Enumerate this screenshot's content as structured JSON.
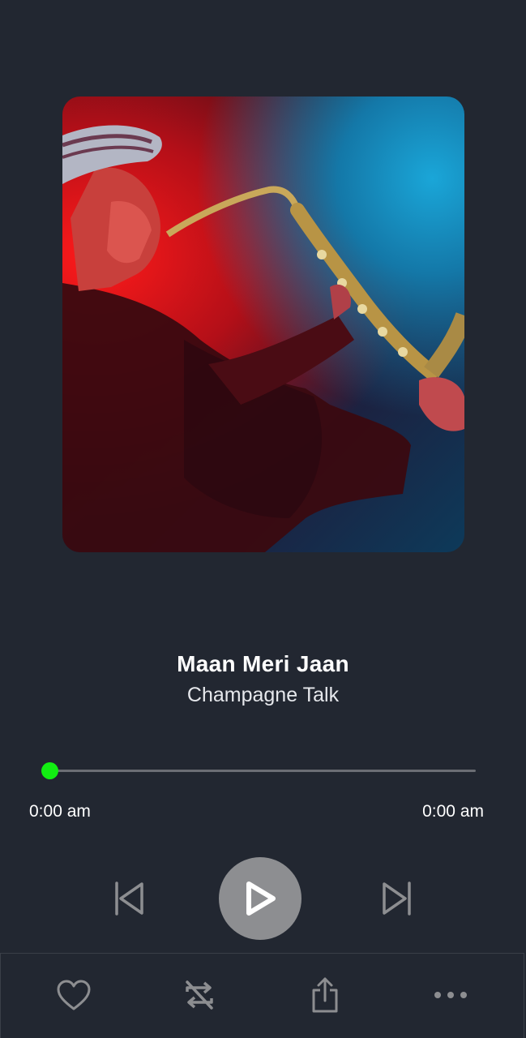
{
  "player": {
    "song_title": "Maan Meri Jaan",
    "artist": "Champagne Talk",
    "progress_fraction": 0.0,
    "elapsed_time": "0:00 am",
    "total_time": "0:00 am"
  },
  "controls": {
    "previous_icon": "skip-previous-icon",
    "play_icon": "play-icon",
    "next_icon": "skip-next-icon"
  },
  "bottom_bar": {
    "items": [
      {
        "icon": "heart-icon"
      },
      {
        "icon": "repeat-off-icon"
      },
      {
        "icon": "share-icon"
      },
      {
        "icon": "more-horizontal-icon"
      }
    ]
  },
  "colors": {
    "background": "#222731",
    "accent": "#12ee12",
    "play_button": "#8d8e91",
    "icon": "#8d8e91"
  }
}
